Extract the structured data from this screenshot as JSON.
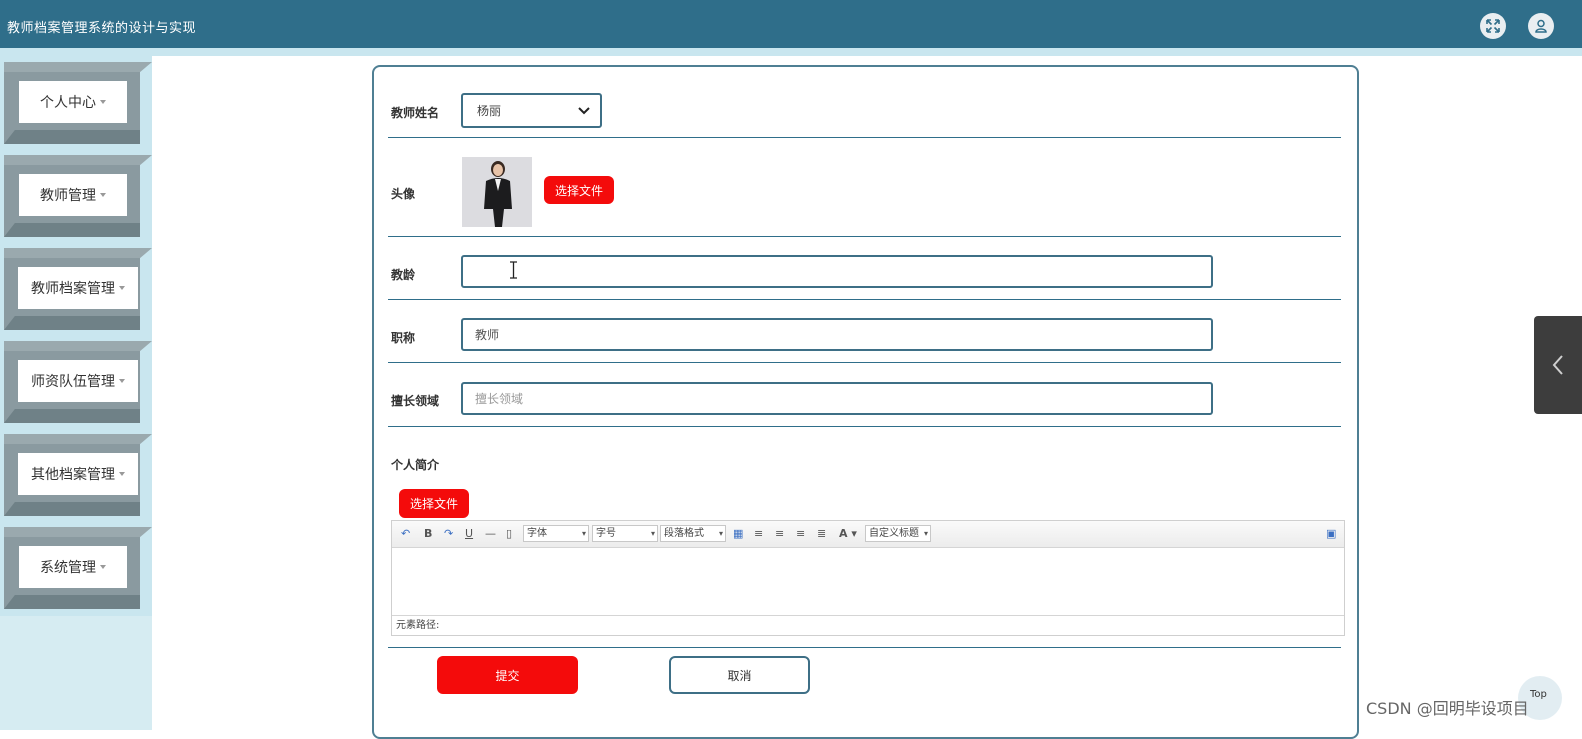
{
  "header": {
    "title": "教师档案管理系统的设计与实现",
    "fullscreen_icon": "expand-icon",
    "user_icon": "user-icon"
  },
  "sidebar": {
    "items": [
      {
        "label": "个人中心"
      },
      {
        "label": "教师管理"
      },
      {
        "label": "教师档案管理"
      },
      {
        "label": "师资队伍管理"
      },
      {
        "label": "其他档案管理"
      },
      {
        "label": "系统管理"
      }
    ]
  },
  "form": {
    "teacher_name_label": "教师姓名",
    "teacher_name_value": "杨丽",
    "avatar_label": "头像",
    "avatar_button": "选择文件",
    "teaching_years_label": "教龄",
    "teaching_years_value": "",
    "title_label": "职称",
    "title_value": "教师",
    "specialty_label": "擅长领域",
    "specialty_placeholder": "擅长领域",
    "intro_label": "个人简介",
    "intro_button": "选择文件",
    "submit_label": "提交",
    "cancel_label": "取消"
  },
  "editor": {
    "font_family": "字体",
    "font_size": "字号",
    "paragraph": "段落格式",
    "custom_title": "自定义标题",
    "font_color_glyph": "A",
    "status": "元素路径:"
  },
  "footer": {
    "watermark": "CSDN @回明毕设项目",
    "top_label": "Top"
  },
  "colors": {
    "header_bg": "#2f6e8a",
    "accent_red": "#f40b0b",
    "border_blue": "#3e6f86"
  }
}
